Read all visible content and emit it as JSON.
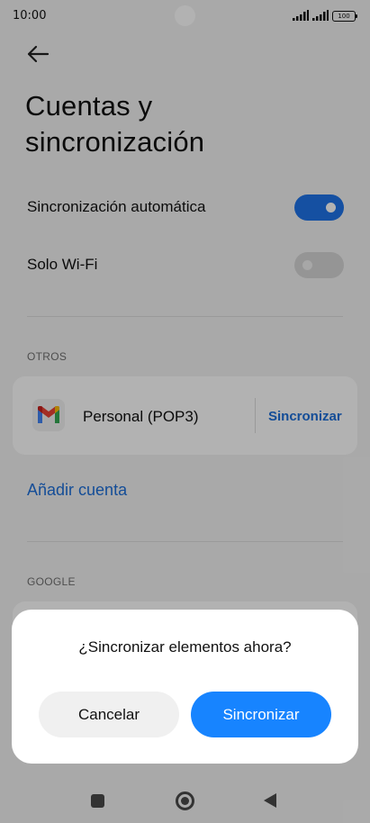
{
  "status_bar": {
    "time": "10:00",
    "battery": "100"
  },
  "header": {
    "title_line1": "Cuentas y",
    "title_line2": "sincronización"
  },
  "settings": {
    "auto_sync_label": "Sincronización automática",
    "auto_sync_on": true,
    "wifi_only_label": "Solo Wi-Fi",
    "wifi_only_on": false
  },
  "others": {
    "section_label": "OTROS",
    "account_name": "Personal (POP3)",
    "sync_label": "Sincronizar",
    "add_account_label": "Añadir cuenta"
  },
  "google": {
    "section_label": "GOOGLE"
  },
  "dialog": {
    "title": "¿Sincronizar elementos ahora?",
    "cancel_label": "Cancelar",
    "confirm_label": "Sincronizar"
  },
  "colors": {
    "accent": "#1f73e8",
    "primary_button": "#1784ff",
    "link": "#1e6fd9"
  },
  "icons": {
    "back": "arrow-left-icon",
    "account": "gmail-icon",
    "nav_recent": "square-icon",
    "nav_home": "circle-icon",
    "nav_back": "triangle-back-icon"
  }
}
